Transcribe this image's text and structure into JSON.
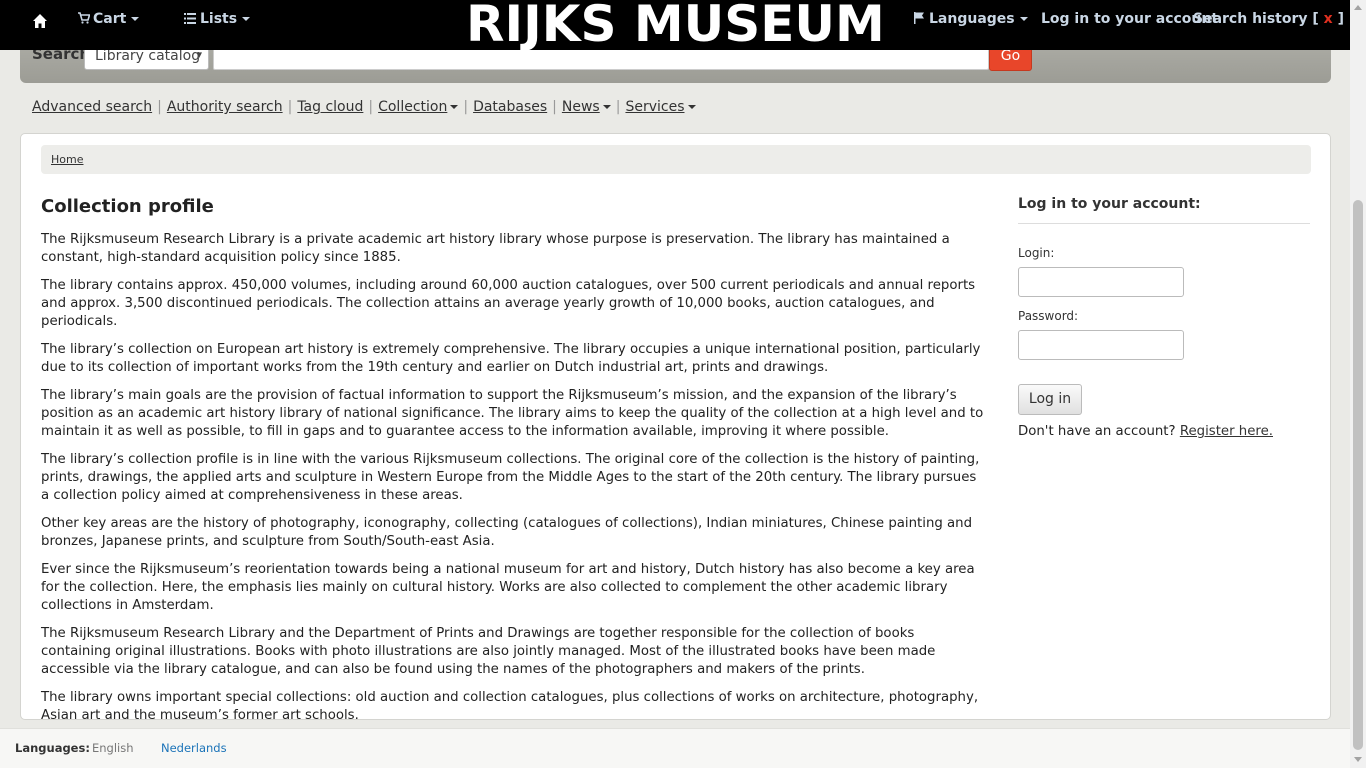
{
  "navbar": {
    "home_icon": "home-icon",
    "cart_label": "Cart",
    "lists_label": "Lists",
    "logo_text": "RIJKS MUSEUM",
    "languages_label": "Languages",
    "login_label": "Log in to your account",
    "search_history_label": "Search history",
    "search_history_clear": "x",
    "search_history_bracket_open": "[",
    "search_history_bracket_close": "]"
  },
  "search": {
    "label": "Search",
    "scope_selected": "Library catalog",
    "query_value": "",
    "go_label": "Go"
  },
  "subnav": {
    "items": [
      {
        "label": "Advanced search",
        "dropdown": false
      },
      {
        "label": "Authority search",
        "dropdown": false
      },
      {
        "label": "Tag cloud",
        "dropdown": false
      },
      {
        "label": "Collection",
        "dropdown": true
      },
      {
        "label": "Databases",
        "dropdown": false
      },
      {
        "label": "News",
        "dropdown": true
      },
      {
        "label": "Services",
        "dropdown": true
      }
    ]
  },
  "breadcrumb": {
    "home": "Home"
  },
  "content": {
    "title": "Collection profile",
    "paragraphs": [
      "The Rijksmuseum Research Library is a private academic art history library whose purpose is preservation. The library has maintained a constant, high-standard acquisition policy since 1885.",
      "The library contains approx. 450,000 volumes, including around 60,000 auction catalogues, over 500 current periodicals and annual reports and approx. 3,500 discontinued periodicals. The collection attains an average yearly growth of 10,000 books, auction catalogues, and periodicals.",
      "The library’s collection on European art history is extremely comprehensive. The library occupies a unique international position, particularly due to its collection of important works from the 19th century and earlier on Dutch industrial art, prints and drawings.",
      "The library’s main goals are the provision of factual information to support the Rijksmuseum’s mission, and the expansion of the library’s position as an academic art history library of national significance. The library aims to keep the quality of the collection at a high level and to maintain it as well as possible, to fill in gaps and to guarantee access to the information available, improving it where possible.",
      "The library’s collection profile is in line with the various Rijksmuseum collections. The original core of the collection is the history of painting, prints, drawings, the applied arts and sculpture in Western Europe from the Middle Ages to the start of the 20th century. The library pursues a collection policy aimed at comprehensiveness in these areas.",
      "Other key areas are the history of photography, iconography, collecting (catalogues of collections), Indian miniatures, Chinese painting and bronzes, Japanese prints, and sculpture from South/South-east Asia.",
      "Ever since the Rijksmuseum’s reorientation towards being a national museum for art and history, Dutch history has also become a key area for the collection. Here, the emphasis lies mainly on cultural history. Works are also collected to complement the other academic library collections in Amsterdam.",
      "The Rijksmuseum Research Library and the Department of Prints and Drawings are together responsible for the collection of books containing original illustrations. Books with photo illustrations are also jointly managed. Most of the illustrated books have been made accessible via the library catalogue, and can also be found using the names of the photographers and makers of the prints.",
      "The library owns important special collections: old auction and collection catalogues, plus collections of works on architecture, photography, Asian art and the museum’s former art schools."
    ]
  },
  "login": {
    "heading": "Log in to your account:",
    "login_label": "Login:",
    "login_value": "",
    "password_label": "Password:",
    "password_value": "",
    "button": "Log in",
    "no_account": "Don't have an account?",
    "register": "Register here."
  },
  "footer": {
    "label": "Languages:",
    "current": "English",
    "alternate": "Nederlands"
  },
  "colors": {
    "navbar_bg": "#000000",
    "nav_link": "#c9d6e4",
    "go_button": "#e8462a",
    "alt_language_link": "#1b73b8"
  }
}
